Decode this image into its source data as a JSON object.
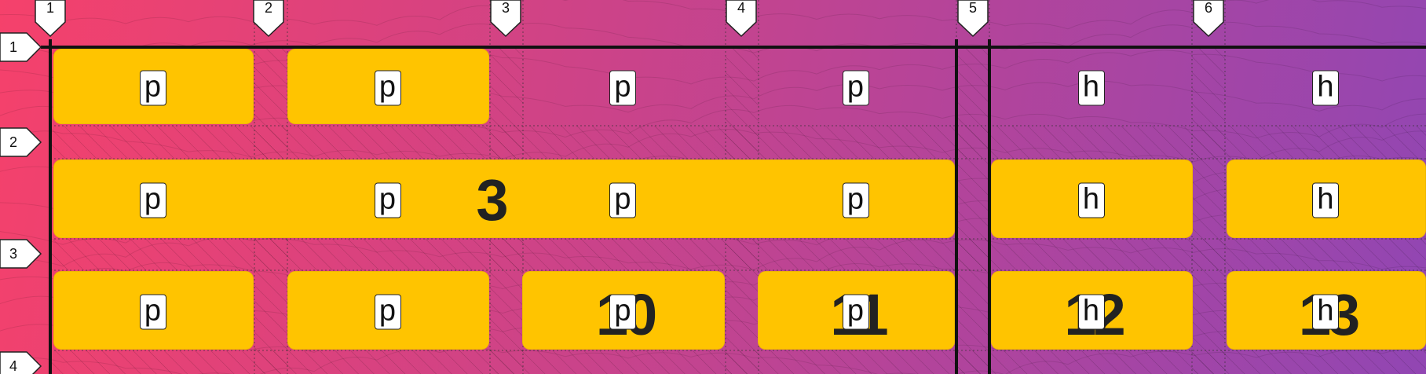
{
  "theme": {
    "gradient_start": "#f5416b",
    "gradient_end": "#9146b3",
    "cell_color": "#ffc400",
    "line_color": "#111111",
    "dotted_color": "#333333",
    "chip_bg": "#ffffff"
  },
  "grid": {
    "column_labels": [
      "1",
      "2",
      "3",
      "4",
      "5",
      "6"
    ],
    "row_labels": [
      "1",
      "2",
      "3",
      "4"
    ]
  },
  "cells": [
    {
      "chip": "p",
      "number": ""
    },
    {
      "chip": "p",
      "number": ""
    },
    {
      "chip": "p",
      "number": ""
    },
    {
      "chip": "p",
      "number": ""
    },
    {
      "chip": "h",
      "number": ""
    },
    {
      "chip": "h",
      "number": ""
    },
    {
      "chip": "p",
      "number": ""
    },
    {
      "chip": "p",
      "number": ""
    },
    {
      "chip": "p",
      "number": ""
    },
    {
      "chip": "p",
      "number": ""
    },
    {
      "chip": "h",
      "number": ""
    },
    {
      "chip": "h",
      "number": ""
    },
    {
      "chip": "p",
      "number": ""
    },
    {
      "chip": "p",
      "number": ""
    },
    {
      "chip": "p",
      "number": "10"
    },
    {
      "chip": "p",
      "number": "11"
    },
    {
      "chip": "h",
      "number": "12"
    },
    {
      "chip": "h",
      "number": "13"
    }
  ],
  "overlay_number": "3"
}
